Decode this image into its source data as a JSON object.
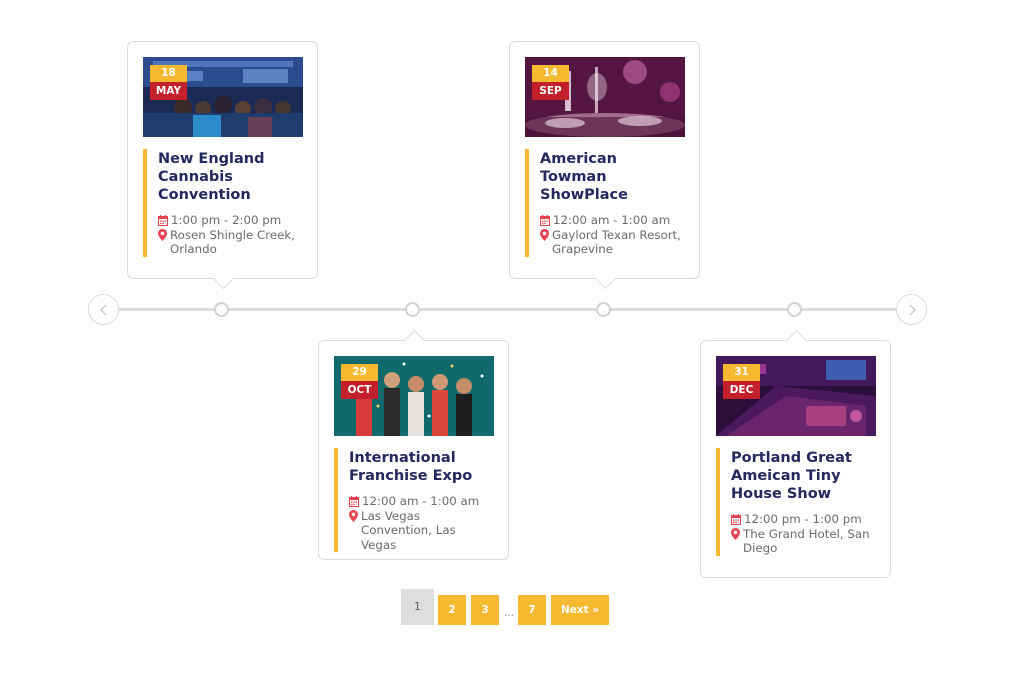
{
  "timeline": {
    "prev_label": "previous-slide",
    "next_label": "next-slide"
  },
  "events": [
    {
      "day": "18",
      "month": "MAY",
      "title": "New England Cannabis Convention",
      "time": "1:00 pm - 2:00 pm",
      "location": "Rosen Shingle Creek, Orlando",
      "image_scene": "convention crowd"
    },
    {
      "day": "29",
      "month": "OCT",
      "title": "International Franchise Expo",
      "time": "12:00 am - 1:00 am",
      "location": "Las Vegas Convention, Las Vegas",
      "image_scene": "party with confetti"
    },
    {
      "day": "14",
      "month": "SEP",
      "title": "American Towman ShowPlace",
      "time": "12:00 am - 1:00 am",
      "location": "Gaylord Texan Resort, Grapevine",
      "image_scene": "banquet hall"
    },
    {
      "day": "31",
      "month": "DEC",
      "title": "Portland Great Ameican Tiny House Show",
      "time": "12:00 pm - 1:00 pm",
      "location": "The Grand Hotel, San Diego",
      "image_scene": "concert stage"
    }
  ],
  "pagination": {
    "current": "1",
    "pages": [
      "2",
      "3"
    ],
    "ellipsis": "…",
    "last": "7",
    "next": "Next »"
  },
  "icons": {
    "calendar": "calendar-icon",
    "location": "map-pin-icon",
    "prev": "chevron-left-icon",
    "next": "chevron-right-icon"
  },
  "colors": {
    "accent_yellow": "#f7b92f",
    "month_red": "#c4202c",
    "title_navy": "#23285f",
    "icon_red": "#e8424f",
    "meta_gray": "#6b6b6b"
  }
}
